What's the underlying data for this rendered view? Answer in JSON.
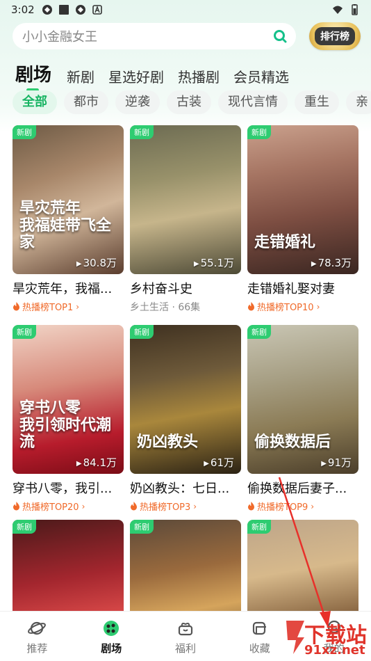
{
  "status_bar": {
    "time": "3:02"
  },
  "search": {
    "placeholder": "小小金融女王",
    "rank_label": "排行榜"
  },
  "tabs": [
    {
      "label": "剧场",
      "active": true
    },
    {
      "label": "新剧"
    },
    {
      "label": "星选好剧"
    },
    {
      "label": "热播剧"
    },
    {
      "label": "会员精选"
    }
  ],
  "chips": [
    {
      "label": "全部",
      "active": true
    },
    {
      "label": "都市"
    },
    {
      "label": "逆袭"
    },
    {
      "label": "古装"
    },
    {
      "label": "现代言情"
    },
    {
      "label": "重生"
    },
    {
      "label": "亲"
    }
  ],
  "cards": [
    {
      "badge": "新剧",
      "views": "30.8万",
      "title": "旱灾荒年，我福...",
      "sub": "热播榜TOP1",
      "sub_type": "hot",
      "art": "旱灾荒年\n我福娃带飞全家"
    },
    {
      "badge": "新剧",
      "views": "55.1万",
      "title": "乡村奋斗史",
      "sub": "乡土生活 · 66集",
      "sub_type": "plain",
      "art": ""
    },
    {
      "badge": "新剧",
      "views": "78.3万",
      "title": "走错婚礼娶对妻",
      "sub": "热播榜TOP10",
      "sub_type": "hot",
      "art": "走错婚礼"
    },
    {
      "badge": "新剧",
      "views": "84.1万",
      "title": "穿书八零，我引...",
      "sub": "热播榜TOP20",
      "sub_type": "hot",
      "art": "穿书八零\n我引领时代潮流"
    },
    {
      "badge": "新剧",
      "views": "61万",
      "title": "奶凶教头：七日...",
      "sub": "热播榜TOP3",
      "sub_type": "hot",
      "art": "奶凶教头"
    },
    {
      "badge": "新剧",
      "views": "91万",
      "title": "偷换数据后妻子...",
      "sub": "热播榜TOP9",
      "sub_type": "hot",
      "art": "偷换数据后"
    },
    {
      "badge": "新剧",
      "views": "",
      "title": "",
      "sub": "",
      "sub_type": "none",
      "art": ""
    },
    {
      "badge": "新剧",
      "views": "",
      "title": "",
      "sub": "",
      "sub_type": "none",
      "art": ""
    },
    {
      "badge": "新剧",
      "views": "",
      "title": "",
      "sub": "",
      "sub_type": "none",
      "art": ""
    }
  ],
  "bottom_nav": [
    {
      "label": "推荐",
      "icon": "planet-icon"
    },
    {
      "label": "剧场",
      "icon": "theater-icon",
      "active": true
    },
    {
      "label": "福利",
      "icon": "gift-icon"
    },
    {
      "label": "收藏",
      "icon": "collection-icon"
    },
    {
      "label": "我的",
      "icon": "profile-icon"
    }
  ],
  "watermark": {
    "line1": "下载站",
    "line2": "91xz.net"
  },
  "colors": {
    "accent": "#2ecc71",
    "hot": "#f06a2a"
  }
}
